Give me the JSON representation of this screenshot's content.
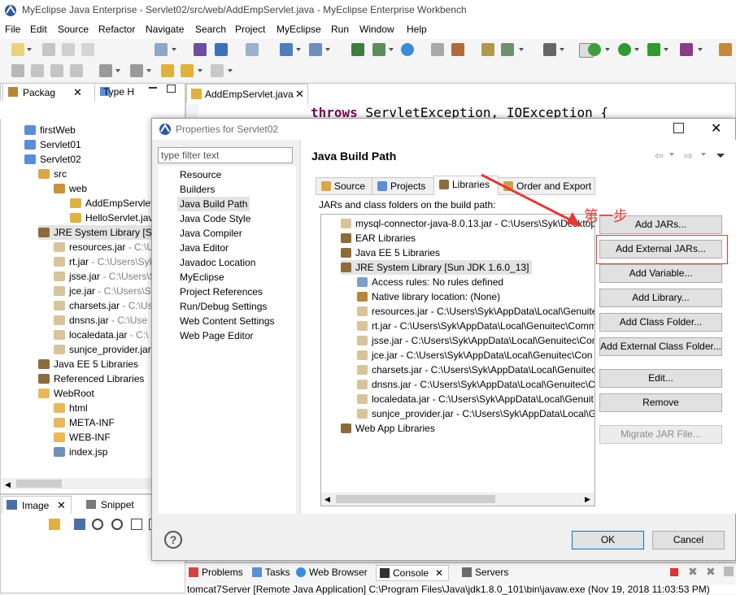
{
  "window": {
    "title": "MyEclipse Java Enterprise - Servlet02/src/web/AddEmpServlet.java - MyEclipse Enterprise Workbench"
  },
  "menubar": [
    "File",
    "Edit",
    "Source",
    "Refactor",
    "Navigate",
    "Search",
    "Project",
    "MyEclipse",
    "Run",
    "Window",
    "Help"
  ],
  "left_panel": {
    "tabs": [
      "Packag",
      "Type H"
    ],
    "tree": [
      {
        "label": "firstWeb"
      },
      {
        "label": "Servlet01"
      },
      {
        "label": "Servlet02"
      },
      {
        "label": "src"
      },
      {
        "label": "web"
      },
      {
        "label": "AddEmpServlet"
      },
      {
        "label": "HelloServlet.jav"
      },
      {
        "label": "JRE System Library [Sun"
      },
      {
        "label": "resources.jar",
        "path": " - C:\\Us"
      },
      {
        "label": "rt.jar",
        "path": " - C:\\Users\\Syk"
      },
      {
        "label": "jsse.jar",
        "path": " - C:\\Users\\S"
      },
      {
        "label": "jce.jar",
        "path": " - C:\\Users\\Sy"
      },
      {
        "label": "charsets.jar",
        "path": " - C:\\Us"
      },
      {
        "label": "dnsns.jar",
        "path": " - C:\\Use"
      },
      {
        "label": "localedata.jar",
        "path": " - C:\\"
      },
      {
        "label": "sunjce_provider.jar"
      },
      {
        "label": "Java EE 5 Libraries"
      },
      {
        "label": "Referenced Libraries"
      },
      {
        "label": "WebRoot"
      },
      {
        "label": "html"
      },
      {
        "label": "META-INF"
      },
      {
        "label": "WEB-INF"
      },
      {
        "label": "index.jsp"
      }
    ]
  },
  "bottom_left_tabs": [
    "Image",
    "Snippet"
  ],
  "editor": {
    "tab": "AddEmpServlet.java",
    "code_keyword": "throws",
    "code_rest": " ServletException, IOException {"
  },
  "console_tabs": [
    "Problems",
    "Tasks",
    "Web Browser",
    "Console",
    "Servers"
  ],
  "console_line": "tomcat7Server [Remote Java Application] C:\\Program Files\\Java\\jdk1.8.0_101\\bin\\javaw.exe (Nov 19, 2018 11:03:53 PM)",
  "dialog": {
    "title": "Properties for Servlet02",
    "filter_placeholder": "type filter text",
    "nav": [
      "Resource",
      "Builders",
      "Java Build Path",
      "Java Code Style",
      "Java Compiler",
      "Java Editor",
      "Javadoc Location",
      "MyEclipse",
      "Project References",
      "Run/Debug Settings",
      "Web Content Settings",
      "Web Page Editor"
    ],
    "selected_nav": "Java Build Path",
    "header": "Java Build Path",
    "tabs": [
      "Source",
      "Projects",
      "Libraries",
      "Order and Export"
    ],
    "active_tab": "Libraries",
    "list_label": "JARs and class folders on the build path:",
    "jars": [
      "mysql-connector-java-8.0.13.jar - C:\\Users\\Syk\\Desktop",
      "EAR Libraries",
      "Java EE 5 Libraries",
      "JRE System Library [Sun JDK 1.6.0_13]",
      "Access rules: No rules defined",
      "Native library location: (None)",
      "resources.jar - C:\\Users\\Syk\\AppData\\Local\\Genuitec",
      "rt.jar - C:\\Users\\Syk\\AppData\\Local\\Genuitec\\Comm",
      "jsse.jar - C:\\Users\\Syk\\AppData\\Local\\Genuitec\\Con",
      "jce.jar - C:\\Users\\Syk\\AppData\\Local\\Genuitec\\Con",
      "charsets.jar - C:\\Users\\Syk\\AppData\\Local\\Genuitec\\",
      "dnsns.jar - C:\\Users\\Syk\\AppData\\Local\\Genuitec\\C",
      "localedata.jar - C:\\Users\\Syk\\AppData\\Local\\Genuit",
      "sunjce_provider.jar - C:\\Users\\Syk\\AppData\\Local\\G",
      "Web App Libraries"
    ],
    "buttons": [
      "Add JARs...",
      "Add External JARs...",
      "Add Variable...",
      "Add Library...",
      "Add Class Folder...",
      "Add External Class Folder...",
      "Edit...",
      "Remove",
      "Migrate JAR File..."
    ],
    "ok": "OK",
    "cancel": "Cancel"
  },
  "annotation": {
    "text": "第一步",
    "color": "#e53935"
  },
  "colors": {
    "accent": "#0078d7",
    "folder": "#e8b85a",
    "jar": "#8a6d3b",
    "keyword": "#7f0055"
  }
}
